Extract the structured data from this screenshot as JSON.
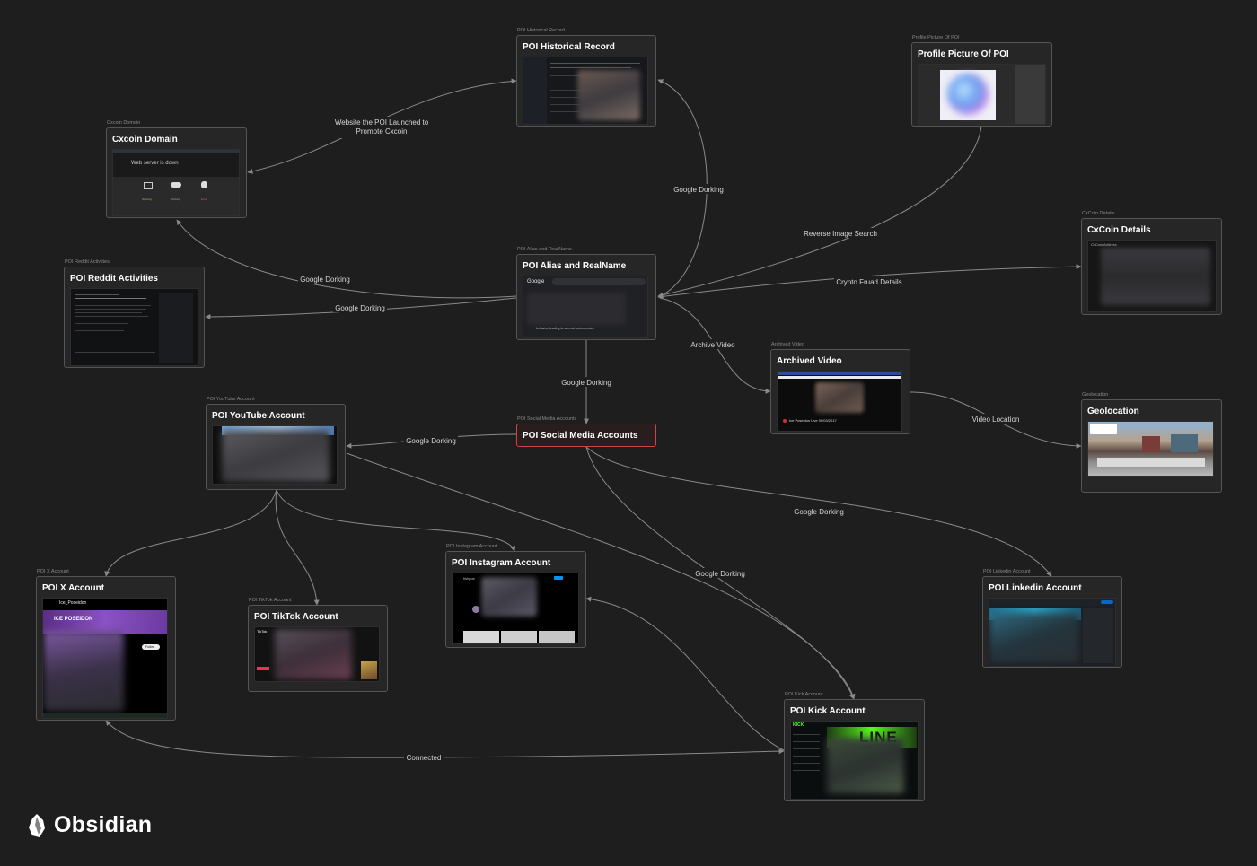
{
  "app": {
    "name": "Obsidian"
  },
  "nodes": {
    "cxcoin_domain": {
      "tag": "Cxcoin Domain",
      "title": "Cxcoin Domain",
      "screenshot_text": "Web server is down",
      "screenshot_status": [
        "Working",
        "Working",
        "Error"
      ]
    },
    "historical_record": {
      "tag": "POI Historical Record",
      "title": "POI Historical Record"
    },
    "profile_picture": {
      "tag": "Profile Picture Of POI",
      "title": "Profile Picture Of POI"
    },
    "cxcoin_details": {
      "tag": "CxCoin Details",
      "title": "CxCoin Details",
      "screenshot_header": "CxCoin Address"
    },
    "reddit": {
      "tag": "POI Reddit Activities",
      "title": "POI Reddit Activities"
    },
    "alias": {
      "tag": "POI Alias and RealName",
      "title": "POI Alias and RealName",
      "screenshot_brand": "Google",
      "screenshot_footer": "behavior, leading to several controversies."
    },
    "archived_video": {
      "tag": "Archived Video",
      "title": "Archived Video",
      "screenshot_caption": "Ice Poseidon Live 09/03/2017"
    },
    "geolocation": {
      "tag": "Geolocation",
      "title": "Geolocation"
    },
    "youtube": {
      "tag": "POI YouTube Account",
      "title": "POI YouTube Account"
    },
    "social": {
      "tag": "POI Social Media Accounts",
      "title": "POI Social Media Accounts"
    },
    "instagram": {
      "tag": "POI Instagram Account",
      "title": "POI Instagram Account",
      "screenshot_handle": "fishpoe"
    },
    "x": {
      "tag": "POI X Account",
      "title": "POI X Account",
      "screenshot_handle": "Ice_Poseidon",
      "screenshot_banner": "ICE POSEIDON",
      "screenshot_button": "Follow"
    },
    "tiktok": {
      "tag": "POI TikTok Account",
      "title": "POI TikTok Account",
      "screenshot_brand": "TikTok"
    },
    "linkedin": {
      "tag": "POI Linkedin Account",
      "title": "POI Linkedin Account"
    },
    "kick": {
      "tag": "POI Kick Account",
      "title": "POI Kick Account",
      "screenshot_brand": "KICK",
      "screenshot_banner": "LINE"
    }
  },
  "edges": {
    "e_website": [
      "Website the POI Launched to",
      "Promote Cxcoin"
    ],
    "e_dork_hist": "Google Dorking",
    "e_reverse": "Reverse Image Search",
    "e_crypto": "Crypto Fruad Details",
    "e_dork_domain": "Google Dorking",
    "e_dork_reddit": "Google Dorking",
    "e_archived": "Archive Video",
    "e_dork_social": "Google Dorking",
    "e_video_loc": "Video Location",
    "e_dork_yt": "Google Dorking",
    "e_dork_linkedin": "Google Dorking",
    "e_dork_kick": "Google Dorking",
    "e_connected": "Connected"
  },
  "colors": {
    "canvas": "#1e1e1e",
    "node_bg": "#262626",
    "node_border": "#555555",
    "selected_border": "#c44848",
    "edge": "#8a8a8a"
  }
}
